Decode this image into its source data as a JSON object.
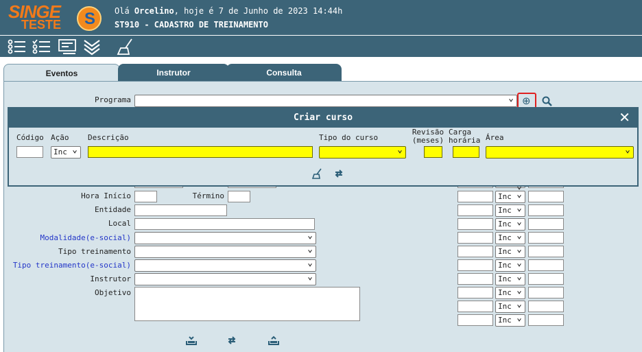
{
  "header": {
    "logo_text": "SINGE",
    "logo_subtext": "TESTE",
    "logo_mark": "S",
    "greeting_prefix": "Olá ",
    "user_name": "Orcelino",
    "greeting_suffix": ", hoje é 7 de Junho de 2023 14:44h",
    "screen_title": "ST910 - CADASTRO DE TREINAMENTO"
  },
  "toolbar": {
    "icons": [
      "list-icon",
      "checklist-icon",
      "form-icon",
      "chevron-stack-icon",
      "broom-icon"
    ]
  },
  "tabs": [
    {
      "label": "Eventos",
      "active": true
    },
    {
      "label": "Instrutor",
      "active": false
    },
    {
      "label": "Consulta",
      "active": false
    }
  ],
  "form": {
    "programa_label": "Programa",
    "hora_inicio_label": "Hora Início",
    "termino_label": "Término",
    "entidade_label": "Entidade",
    "local_label": "Local",
    "modalidade_label": "Modalidade(e-social)",
    "tipo_treinamento_label": "Tipo treinamento",
    "tipo_treinamento_esocial_label": "Tipo treinamento(e-social)",
    "instrutor_label": "Instrutor",
    "objetivo_label": "Objetivo"
  },
  "right_grid": {
    "row_select_value": "Inc"
  },
  "modal": {
    "title": "Criar curso",
    "codigo_label": "Código",
    "acao_label": "Ação",
    "descricao_label": "Descrição",
    "tipo_curso_label": "Tipo do curso",
    "revisao_label_1": "Revisão",
    "revisao_label_2": "(meses)",
    "carga_label_1": "Carga",
    "carga_label_2": "horária",
    "area_label": "Área",
    "acao_value": "Inc"
  },
  "colors": {
    "header_bg": "#3c6478",
    "panel_bg": "#d7e4ea",
    "required_field": "#ffff00",
    "logo_orange": "#f27a1a",
    "highlight_red": "#e02020"
  }
}
